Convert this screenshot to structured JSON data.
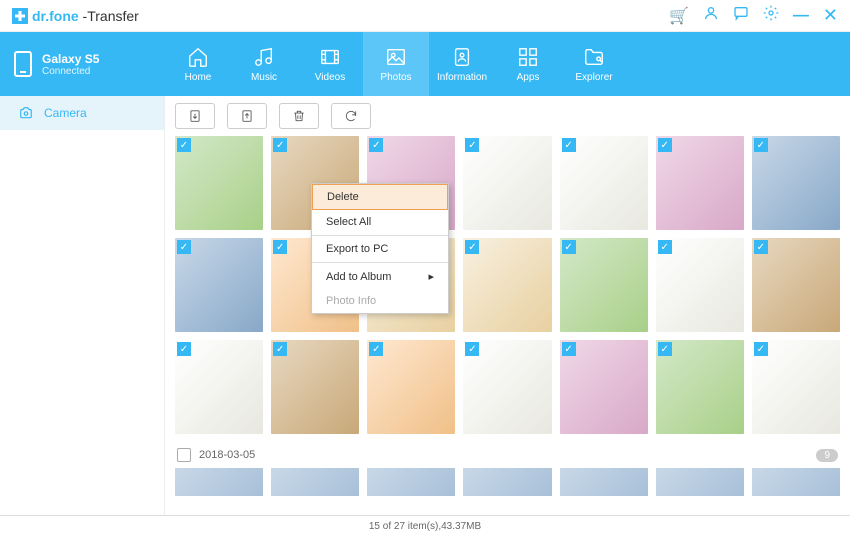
{
  "app": {
    "brand": "dr.fone",
    "suffix": " -Transfer"
  },
  "device": {
    "name": "Galaxy S5",
    "status": "Connected"
  },
  "tabs": [
    {
      "label": "Home"
    },
    {
      "label": "Music"
    },
    {
      "label": "Videos"
    },
    {
      "label": "Photos"
    },
    {
      "label": "Information"
    },
    {
      "label": "Apps"
    },
    {
      "label": "Explorer"
    }
  ],
  "sidebar": {
    "camera": "Camera"
  },
  "contextMenu": {
    "delete": "Delete",
    "selectAll": "Select All",
    "export": "Export to PC",
    "addToAlbum": "Add to Album",
    "photoInfo": "Photo Info"
  },
  "dateGroup": {
    "date": "2018-03-05",
    "count": "9"
  },
  "status": "15 of 27 item(s),43.37MB"
}
